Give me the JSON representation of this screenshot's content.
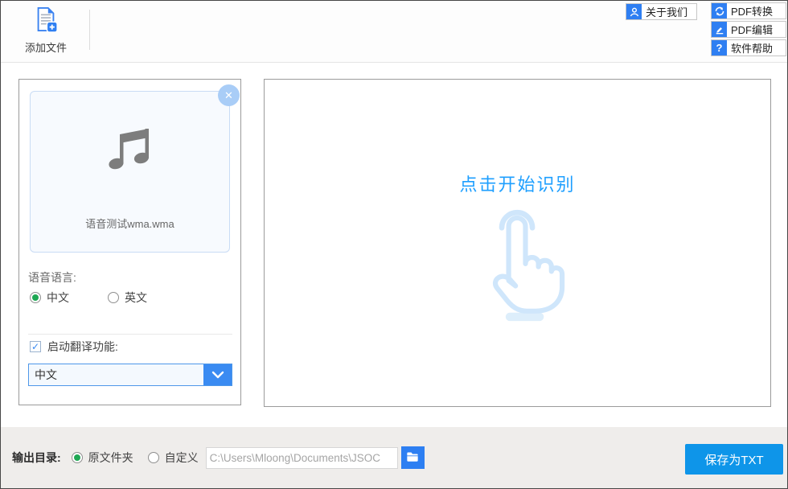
{
  "header": {
    "add_file_label": "添加文件",
    "about_label": "关于我们",
    "pdf_convert_label": "PDF转换",
    "pdf_edit_label": "PDF编辑",
    "help_label": "软件帮助",
    "help_icon_glyph": "?"
  },
  "file_panel": {
    "file_name": "语音测试wma.wma",
    "close_icon_glyph": "✕",
    "language_label": "语音语言:",
    "language_options": [
      {
        "label": "中文",
        "selected": true
      },
      {
        "label": "英文",
        "selected": false
      }
    ],
    "translate_label": "启动翻译功能:",
    "translate_checked": true,
    "check_icon_glyph": "✓",
    "translate_select_value": "中文"
  },
  "recognition_panel": {
    "prompt": "点击开始识别"
  },
  "bottom_bar": {
    "output_label": "输出目录:",
    "dir_options": [
      {
        "label": "原文件夹",
        "selected": true
      },
      {
        "label": "自定义",
        "selected": false
      }
    ],
    "path_value": "C:\\Users\\Mloong\\Documents\\JSOC",
    "save_label": "保存为TXT"
  },
  "colors": {
    "accent_blue": "#2f7ff2",
    "save_button_blue": "#0e95e9",
    "prompt_blue": "#1e9fff",
    "radio_green": "#1fa854",
    "card_bg": "#f7fafe",
    "card_border": "#c9dcf5",
    "bottom_bar_bg": "#efedeb"
  }
}
